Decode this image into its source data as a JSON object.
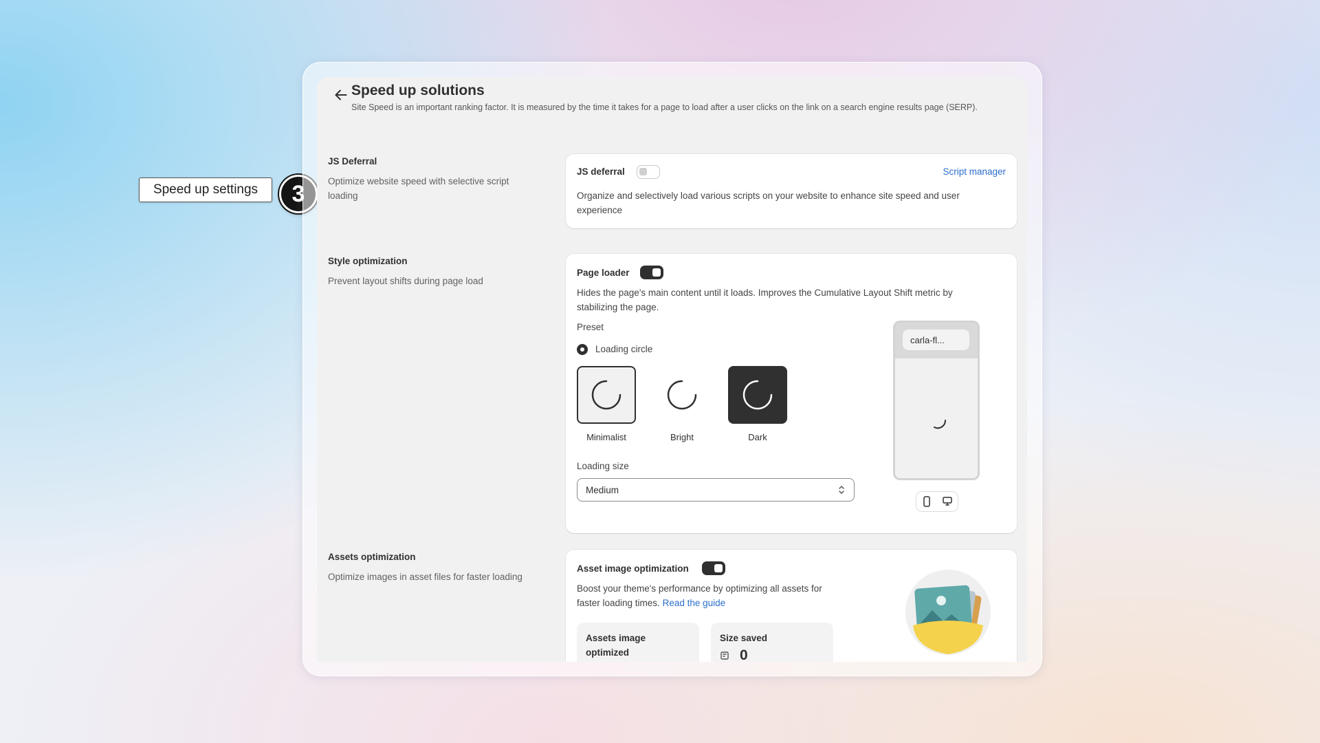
{
  "callout": {
    "label": "Speed up settings",
    "step": "3"
  },
  "header": {
    "title": "Speed up solutions",
    "description": "Site Speed is an important ranking factor. It is measured by the time it takes for a page to load after a user clicks on the link on a search engine results page (SERP)."
  },
  "sections": {
    "js": {
      "title": "JS Deferral",
      "description": "Optimize website speed with selective script loading",
      "card": {
        "label": "JS deferral",
        "enabled": false,
        "link": "Script manager",
        "text": "Organize and selectively load various scripts on your website to enhance site speed and user experience"
      }
    },
    "style": {
      "title": "Style optimization",
      "description": "Prevent layout shifts during page load",
      "card": {
        "label": "Page loader",
        "enabled": true,
        "text": "Hides the page's main content until it loads. Improves the Cumulative Layout Shift metric by stabilizing the page.",
        "preset_label": "Preset",
        "preset_option": "Loading circle",
        "presets": [
          {
            "label": "Minimalist",
            "selected": true
          },
          {
            "label": "Bright",
            "selected": false
          },
          {
            "label": "Dark",
            "selected": false
          }
        ],
        "size_label": "Loading size",
        "size_value": "Medium",
        "preview_url": "carla-fl..."
      }
    },
    "assets": {
      "title": "Assets optimization",
      "description": "Optimize images in asset files for faster loading",
      "card": {
        "label": "Asset image optimization",
        "enabled": true,
        "text": "Boost your theme's performance by optimizing all assets for faster loading times.",
        "link": "Read the guide",
        "stats": [
          {
            "label": "Assets image optimized",
            "value": ""
          },
          {
            "label": "Size saved",
            "value": "0"
          }
        ]
      }
    }
  },
  "colors": {
    "accent": "#2c6ecb",
    "dark": "#303030",
    "page_bg": "#f1f1f1"
  }
}
